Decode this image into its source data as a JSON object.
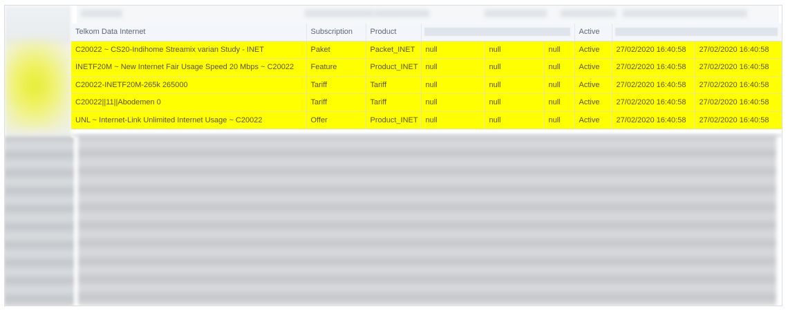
{
  "table": {
    "columns": [
      {
        "label": "Telkom Data Internet"
      },
      {
        "label": "Subscription"
      },
      {
        "label": "Product"
      },
      {
        "label": ""
      },
      {
        "label": ""
      },
      {
        "label": ""
      },
      {
        "label": "Active"
      },
      {
        "label": ""
      },
      {
        "label": ""
      }
    ],
    "rows": [
      {
        "cells": [
          "C20022 ~ CS20-Indihome Streamix varian Study - INET",
          "Paket",
          "Packet_INET",
          "null",
          "null",
          "null",
          "Active",
          "27/02/2020 16:40:58",
          "27/02/2020 16:40:58"
        ]
      },
      {
        "cells": [
          "INETF20M ~ New Internet Fair Usage Speed 20 Mbps ~ C20022",
          "Feature",
          "Product_INET",
          "null",
          "null",
          "null",
          "Active",
          "27/02/2020 16:40:58",
          "27/02/2020 16:40:58"
        ]
      },
      {
        "cells": [
          "C20022-INETF20M-265k 265000",
          "Tariff",
          "Tariff",
          "null",
          "null",
          "null",
          "Active",
          "27/02/2020 16:40:58",
          "27/02/2020 16:40:58"
        ]
      },
      {
        "cells": [
          "C20022||11||Abodemen 0",
          "Tariff",
          "Tariff",
          "null",
          "null",
          "null",
          "Active",
          "27/02/2020 16:40:58",
          "27/02/2020 16:40:58"
        ]
      },
      {
        "cells": [
          "UNL ~ Internet-Link Unlimited Internet Usage ~ C20022",
          "Offer",
          "Product_INET",
          "null",
          "null",
          "null",
          "Active",
          "27/02/2020 16:40:58",
          "27/02/2020 16:40:58"
        ]
      }
    ]
  },
  "colors": {
    "highlight": "#ffff00",
    "header_bg": "#f3f7fb",
    "border": "#d8dde3"
  }
}
